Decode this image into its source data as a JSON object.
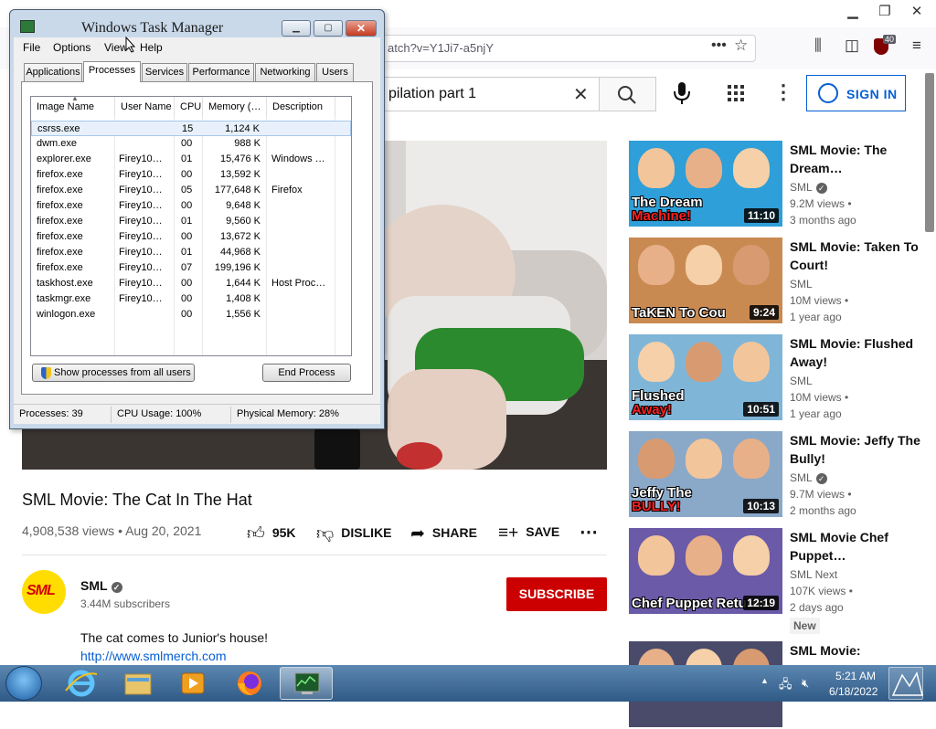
{
  "firefox": {
    "url": "atch?v=Y1Ji7-a5njY",
    "ublock_count": "40",
    "icons": [
      "minimize-icon",
      "restore-icon",
      "close-icon",
      "page-actions-icon",
      "bookmark-star-icon",
      "library-icon",
      "sidebar-icon",
      "ublock-icon",
      "menu-icon"
    ]
  },
  "youtube": {
    "search_text": "pilation part 1",
    "signin_label": "SIGN IN",
    "video": {
      "title": "SML Movie: The Cat In The Hat",
      "meta": "4,908,538 views • Aug 20, 2021",
      "likes": "95K",
      "dislike_label": "DISLIKE",
      "share_label": "SHARE",
      "save_label": "SAVE"
    },
    "channel": {
      "name": "SML",
      "logo_text": "SML",
      "subscribers": "3.44M subscribers",
      "subscribe_label": "SUBSCRIBE"
    },
    "description": "The cat comes to Junior's house!",
    "description_link": "http://www.smlmerch.com",
    "recommendations": [
      {
        "title": "SML Movie: The Dream…",
        "channel": "SML",
        "verified": true,
        "views": "9.2M views •",
        "age": "3 months ago",
        "duration": "11:10",
        "cap_white": "The Dream",
        "cap_red": "Machine!",
        "thumb_color": "#2e9fd8"
      },
      {
        "title": "SML Movie: Taken To Court!",
        "channel": "SML",
        "verified": false,
        "views": "10M views •",
        "age": "1 year ago",
        "duration": "9:24",
        "cap_white": "TaKEN To Cou",
        "cap_red": "",
        "thumb_color": "#c98a52"
      },
      {
        "title": "SML Movie: Flushed Away!",
        "channel": "SML",
        "verified": false,
        "views": "10M views •",
        "age": "1 year ago",
        "duration": "10:51",
        "cap_white": "Flushed",
        "cap_red": "Away!",
        "thumb_color": "#7fb6d8"
      },
      {
        "title": "SML Movie: Jeffy The Bully!",
        "channel": "SML",
        "verified": true,
        "views": "9.7M views •",
        "age": "2 months ago",
        "duration": "10:13",
        "cap_white": "Jeffy The",
        "cap_red": "BULLY!",
        "thumb_color": "#8aa8c8"
      },
      {
        "title": "SML Movie Chef Puppet…",
        "channel": "SML Next",
        "verified": false,
        "views": "107K views •",
        "age": "2 days ago",
        "duration": "12:19",
        "cap_white": "Chef Puppet Returns!",
        "cap_red": "",
        "thumb_color": "#6a5aa8",
        "badge": "New"
      },
      {
        "title": "SML Movie:",
        "channel": "",
        "verified": false,
        "views": "",
        "age": "",
        "duration": "",
        "cap_white": "",
        "cap_red": "",
        "thumb_color": "#4a4a6a"
      }
    ]
  },
  "taskmanager": {
    "title": "Windows Task Manager",
    "menu": [
      "File",
      "Options",
      "View",
      "Help"
    ],
    "tabs": [
      "Applications",
      "Processes",
      "Services",
      "Performance",
      "Networking",
      "Users"
    ],
    "active_tab": "Processes",
    "columns": [
      "Image Name",
      "User Name",
      "CPU",
      "Memory (…",
      "Description"
    ],
    "processes": [
      {
        "image": "csrss.exe",
        "user": "",
        "cpu": "15",
        "mem": "1,124 K",
        "desc": ""
      },
      {
        "image": "dwm.exe",
        "user": "",
        "cpu": "00",
        "mem": "988 K",
        "desc": ""
      },
      {
        "image": "explorer.exe",
        "user": "Firey10…",
        "cpu": "01",
        "mem": "15,476 K",
        "desc": "Windows …"
      },
      {
        "image": "firefox.exe",
        "user": "Firey10…",
        "cpu": "00",
        "mem": "13,592 K",
        "desc": ""
      },
      {
        "image": "firefox.exe",
        "user": "Firey10…",
        "cpu": "05",
        "mem": "177,648 K",
        "desc": "Firefox"
      },
      {
        "image": "firefox.exe",
        "user": "Firey10…",
        "cpu": "00",
        "mem": "9,648 K",
        "desc": ""
      },
      {
        "image": "firefox.exe",
        "user": "Firey10…",
        "cpu": "01",
        "mem": "9,560 K",
        "desc": ""
      },
      {
        "image": "firefox.exe",
        "user": "Firey10…",
        "cpu": "00",
        "mem": "13,672 K",
        "desc": ""
      },
      {
        "image": "firefox.exe",
        "user": "Firey10…",
        "cpu": "01",
        "mem": "44,968 K",
        "desc": ""
      },
      {
        "image": "firefox.exe",
        "user": "Firey10…",
        "cpu": "07",
        "mem": "199,196 K",
        "desc": ""
      },
      {
        "image": "taskhost.exe",
        "user": "Firey10…",
        "cpu": "00",
        "mem": "1,644 K",
        "desc": "Host Proc…"
      },
      {
        "image": "taskmgr.exe",
        "user": "Firey10…",
        "cpu": "00",
        "mem": "1,408 K",
        "desc": ""
      },
      {
        "image": "winlogon.exe",
        "user": "",
        "cpu": "00",
        "mem": "1,556 K",
        "desc": ""
      }
    ],
    "selected_row": 0,
    "show_all_label": "Show processes from all users",
    "end_process_label": "End Process",
    "status_processes": "Processes: 39",
    "status_cpu": "CPU Usage: 100%",
    "status_memory": "Physical Memory: 28%"
  },
  "taskbar": {
    "apps": [
      "start-orb",
      "internet-explorer",
      "windows-explorer",
      "media-player",
      "firefox",
      "task-manager"
    ],
    "time": "5:21 AM",
    "date": "6/18/2022"
  },
  "colors": {
    "yt_red": "#cc0000",
    "yt_blue": "#065fd4",
    "taskbar": "#2f5a86"
  }
}
